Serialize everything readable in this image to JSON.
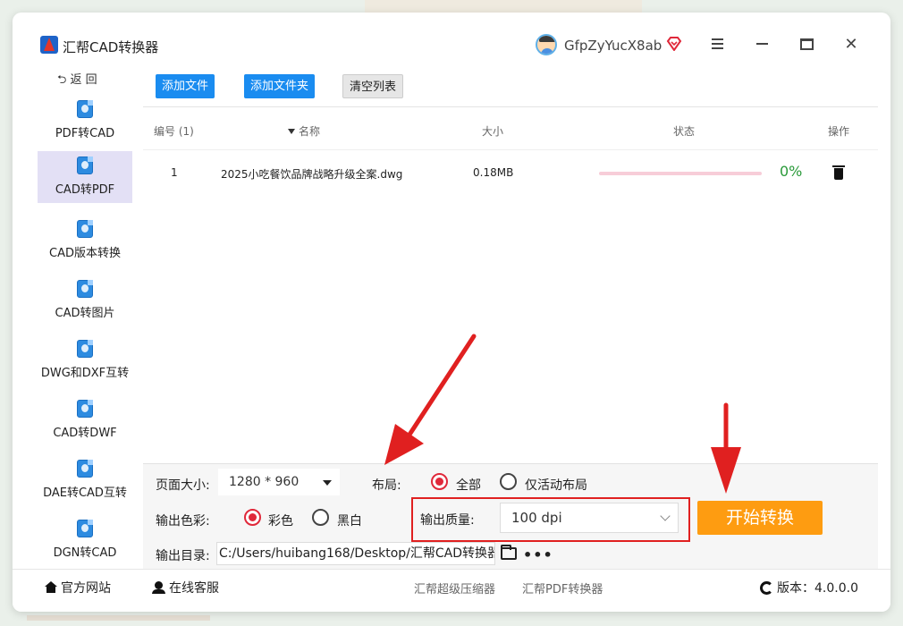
{
  "app": {
    "title": "汇帮CAD转换器",
    "username": "GfpZyYucX8ab"
  },
  "sidebar": {
    "back_label": "⮌ 返 回",
    "items": [
      {
        "label": "PDF转CAD"
      },
      {
        "label": "CAD转PDF",
        "active": true
      },
      {
        "label": "CAD版本转换"
      },
      {
        "label": "CAD转图片"
      },
      {
        "label": "DWG和DXF互转"
      },
      {
        "label": "CAD转DWF"
      },
      {
        "label": "DAE转CAD互转"
      },
      {
        "label": "DGN转CAD"
      }
    ]
  },
  "toolbar": {
    "add_file": "添加文件",
    "add_folder": "添加文件夹",
    "clear_list": "清空列表"
  },
  "table": {
    "headers": {
      "index": "编号 (1)",
      "name": "名称",
      "size": "大小",
      "status": "状态",
      "action": "操作"
    },
    "rows": [
      {
        "index": "1",
        "name": "2025小吃餐饮品牌战略升级全案.dwg",
        "size": "0.18MB",
        "progress": 0,
        "status": "0%"
      }
    ]
  },
  "settings": {
    "page_size_label": "页面大小:",
    "page_size_value": "1280 * 960",
    "layout_label": "布局:",
    "layout_options": [
      "全部",
      "仅活动布局"
    ],
    "color_label": "输出色彩:",
    "color_options": [
      "彩色",
      "黑白"
    ],
    "quality_label": "输出质量:",
    "quality_value": "100 dpi",
    "start_button": "开始转换",
    "output_dir_label": "输出目录:",
    "output_dir_value": "C:/Users/huibang168/Desktop/汇帮CAD转换器",
    "more": "•••"
  },
  "footer": {
    "website": "官方网站",
    "support": "在线客服",
    "link1": "汇帮超级压缩器",
    "link2": "汇帮PDF转换器",
    "version": "版本：4.0.0.0"
  },
  "colors": {
    "accent_blue": "#1a8cf0",
    "start_orange": "#fe9c11",
    "radio_red": "#e0283a",
    "progress_track": "#f7cdd8",
    "status_green": "#2a9a3a",
    "annotation_red": "#e02020"
  }
}
